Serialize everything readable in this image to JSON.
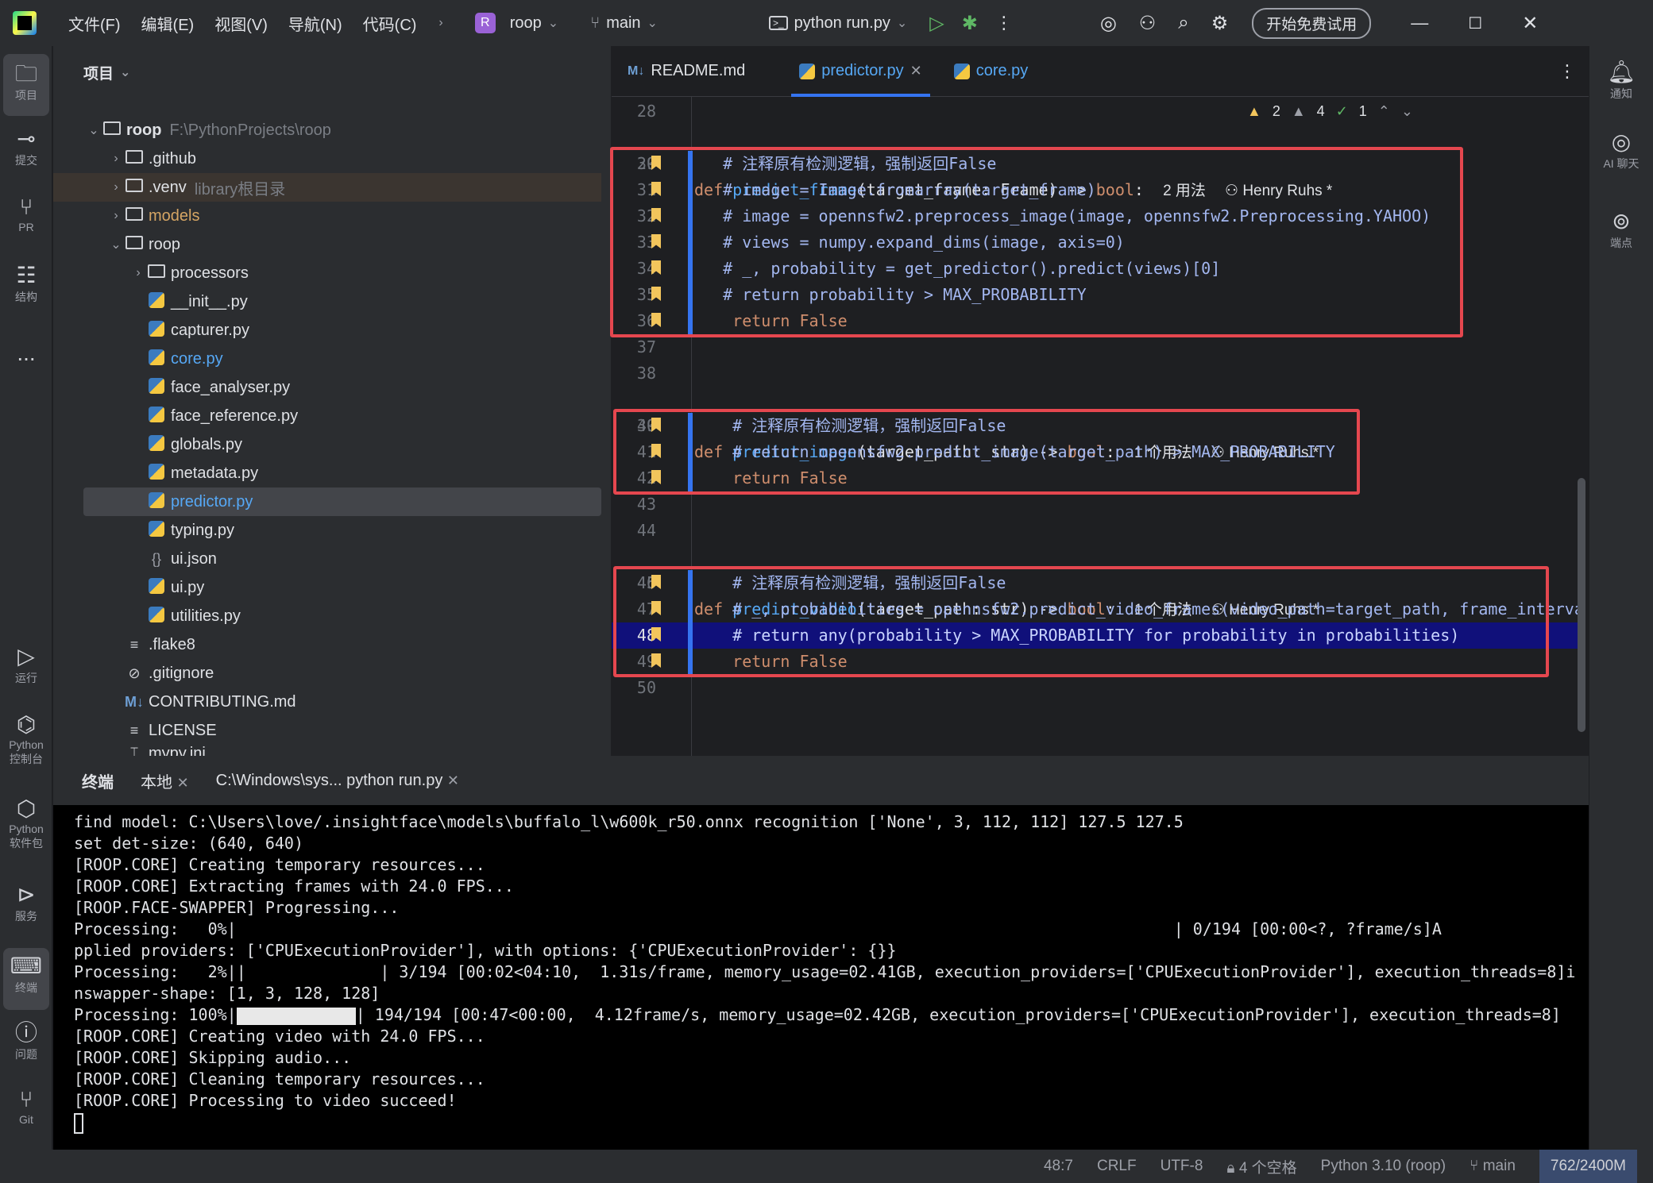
{
  "titlebar": {
    "menu": [
      "文件(F)",
      "编辑(E)",
      "视图(V)",
      "导航(N)",
      "代码(C)"
    ],
    "project_letter": "R",
    "project_name": "roop",
    "branch": "main",
    "run_config": "python run.py",
    "trial_button": "开始免费试用"
  },
  "left_tools": {
    "project": "项目",
    "commit": "提交",
    "pr": "PR",
    "structure": "结构",
    "more": "...",
    "run": "运行",
    "python_console": "Python 控制台",
    "python_packages": "Python 软件包",
    "services": "服务",
    "terminal": "终端",
    "problems": "问题",
    "git": "Git"
  },
  "right_tools": {
    "notifications": "通知",
    "ai_chat": "AI 聊天",
    "endpoints": "端点"
  },
  "project_panel": {
    "title": "项目",
    "root_name": "roop",
    "root_path": "F:\\PythonProjects\\roop",
    "items": [
      {
        "name": ".github"
      },
      {
        "name": ".venv",
        "note": "library根目录"
      },
      {
        "name": "models"
      },
      {
        "name": "roop"
      },
      {
        "name": "processors"
      },
      {
        "name": "__init__.py"
      },
      {
        "name": "capturer.py"
      },
      {
        "name": "core.py"
      },
      {
        "name": "face_analyser.py"
      },
      {
        "name": "face_reference.py"
      },
      {
        "name": "globals.py"
      },
      {
        "name": "metadata.py"
      },
      {
        "name": "predictor.py"
      },
      {
        "name": "typing.py"
      },
      {
        "name": "ui.json"
      },
      {
        "name": "ui.py"
      },
      {
        "name": "utilities.py"
      },
      {
        "name": ".flake8"
      },
      {
        "name": ".gitignore"
      },
      {
        "name": "CONTRIBUTING.md"
      },
      {
        "name": "LICENSE"
      },
      {
        "name": "mypy.ini"
      }
    ]
  },
  "editor": {
    "tabs": [
      {
        "badge": "M↓",
        "label": "README.md"
      },
      {
        "label": "predictor.py"
      },
      {
        "label": "core.py"
      }
    ],
    "inspections": {
      "warnings": "2",
      "weak_warnings": "4",
      "ok": "1"
    },
    "lines": [
      {
        "n": "28"
      },
      {
        "n": "29",
        "kw": "def ",
        "fn": "predict_frame",
        "sig": "(target_frame: Frame) -> ",
        "ret": "bool",
        "colon": ":",
        "hint": "2 用法",
        "author": "Henry Ruhs *"
      },
      {
        "n": "30",
        "comment": "   # 注释原有检测逻辑，强制返回False"
      },
      {
        "n": "31",
        "comment": "   # image = Image.fromarray(target_frame)"
      },
      {
        "n": "32",
        "comment": "   # image = opennsfw2.preprocess_image(image, opennsfw2.Preprocessing.YAHOO)"
      },
      {
        "n": "33",
        "comment": "   # views = numpy.expand_dims(image, axis=0)"
      },
      {
        "n": "34",
        "comment": "   # _, probability = get_predictor().predict(views)[0]"
      },
      {
        "n": "35",
        "comment": "   # return probability > MAX_PROBABILITY"
      },
      {
        "n": "36",
        "ret_kw": "    return ",
        "ret_val": "False"
      },
      {
        "n": "37"
      },
      {
        "n": "38"
      },
      {
        "n": "39",
        "kw": "def ",
        "fn": "predict_image",
        "sig": "(target_path: str) -> ",
        "ret": "bool",
        "colon": ":",
        "hint": "1 个用法",
        "author": "Henry Ruhs *"
      },
      {
        "n": "40",
        "comment": "    # 注释原有检测逻辑，强制返回False"
      },
      {
        "n": "41",
        "comment": "    # return opennsfw2.predict_image(target_path) > MAX_PROBABILITY"
      },
      {
        "n": "42",
        "ret_kw": "    return ",
        "ret_val": "False"
      },
      {
        "n": "43"
      },
      {
        "n": "44"
      },
      {
        "n": "45",
        "kw": "def ",
        "fn": "predict_video",
        "sig": "(target_path: str) -> ",
        "ret": "bool",
        "colon": ":",
        "hint": "1 个用法",
        "author": "Henry Ruhs *"
      },
      {
        "n": "46",
        "comment": "    # 注释原有检测逻辑，强制返回False"
      },
      {
        "n": "47",
        "comment": "    # _, probabilities = opennsfw2.predict_video_frames(video_path=target_path, frame_interva"
      },
      {
        "n": "48",
        "comment": "    # return any(probability > MAX_PROBABILITY for probability in probabilities)"
      },
      {
        "n": "49",
        "ret_kw": "    return ",
        "ret_val": "False"
      },
      {
        "n": "50"
      }
    ]
  },
  "terminal": {
    "title": "终端",
    "tabs": [
      "本地",
      "C:\\Windows\\sys... python  run.py"
    ],
    "lines": [
      "find model: C:\\Users\\love/.insightface\\models\\buffalo_l\\w600k_r50.onnx recognition ['None', 3, 112, 112] 127.5 127.5",
      "set det-size: (640, 640)",
      "[ROOP.CORE] Creating temporary resources...",
      "[ROOP.CORE] Extracting frames with 24.0 FPS...",
      "[ROOP.FACE-SWAPPER] Progressing...",
      "Processing:   0%|                                                                                                  | 0/194 [00:00<?, ?frame/s]A",
      "pplied providers: ['CPUExecutionProvider'], with options: {'CPUExecutionProvider': {}}",
      "Processing:   2%||              | 3/194 [00:02<04:10,  1.31s/frame, memory_usage=02.41GB, execution_providers=['CPUExecutionProvider'], execution_threads=8]i",
      "nswapper-shape: [1, 3, 128, 128]",
      "Processing: 100%|",
      "[ROOP.CORE] Creating video with 24.0 FPS...",
      "[ROOP.CORE] Skipping audio...",
      "[ROOP.CORE] Cleaning temporary resources...",
      "[ROOP.CORE] Processing to video succeed!"
    ],
    "progress_tail": "| 194/194 [00:47<00:00,  4.12frame/s, memory_usage=02.42GB, execution_providers=['CPUExecutionProvider'], execution_threads=8]",
    "progress_complete": 1.0
  },
  "statusbar": {
    "position": "48:7",
    "line_sep": "CRLF",
    "encoding": "UTF-8",
    "indent": "4 个空格",
    "interpreter": "Python 3.10 (roop)",
    "branch": "main",
    "memory": "762/2400M"
  }
}
